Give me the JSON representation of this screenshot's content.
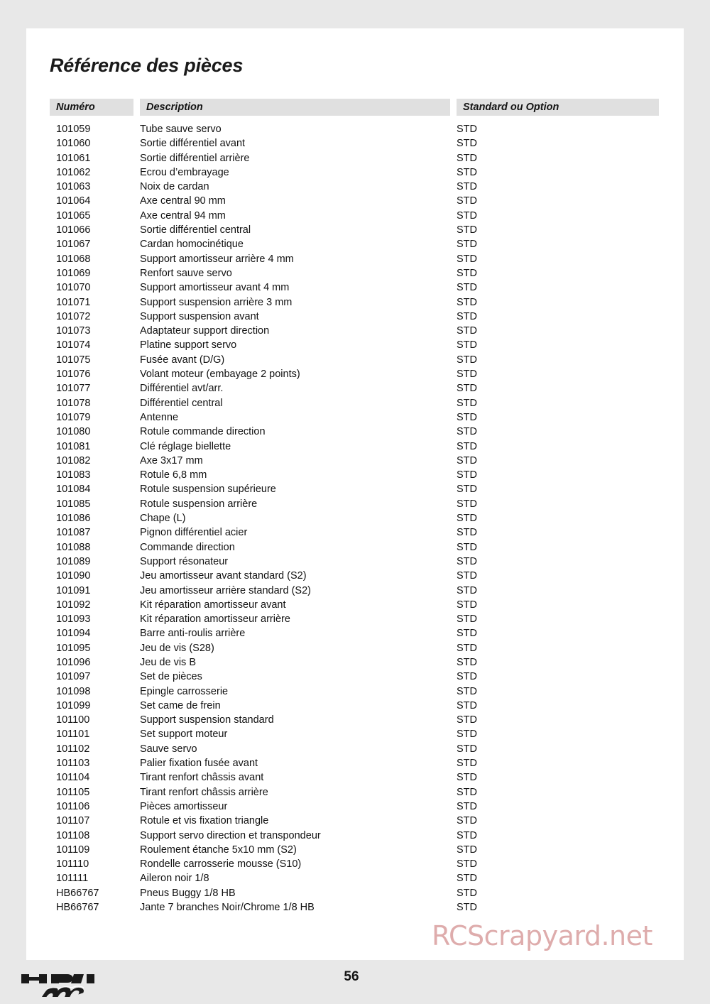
{
  "document": {
    "title": "Référence des pièces",
    "page_number": "56",
    "watermark": "RCScrapyard.net",
    "brand_logo": "hpi-racing-logo"
  },
  "table": {
    "columns": [
      {
        "key": "number",
        "label": "Numéro"
      },
      {
        "key": "description",
        "label": "Description"
      },
      {
        "key": "option",
        "label": "Standard ou Option"
      }
    ],
    "rows": [
      {
        "number": "101059",
        "description": "Tube sauve servo",
        "option": "STD"
      },
      {
        "number": "101060",
        "description": "Sortie différentiel avant",
        "option": "STD"
      },
      {
        "number": "101061",
        "description": "Sortie différentiel arrière",
        "option": "STD"
      },
      {
        "number": "101062",
        "description": "Ecrou d’embrayage",
        "option": "STD"
      },
      {
        "number": "101063",
        "description": "Noix de cardan",
        "option": "STD"
      },
      {
        "number": "101064",
        "description": "Axe central 90 mm",
        "option": "STD"
      },
      {
        "number": "101065",
        "description": "Axe central 94 mm",
        "option": "STD"
      },
      {
        "number": "101066",
        "description": "Sortie différentiel central",
        "option": "STD"
      },
      {
        "number": "101067",
        "description": "Cardan homocinétique",
        "option": "STD"
      },
      {
        "number": "101068",
        "description": "Support amortisseur arrière 4 mm",
        "option": "STD"
      },
      {
        "number": "101069",
        "description": "Renfort sauve servo",
        "option": "STD"
      },
      {
        "number": "101070",
        "description": "Support amortisseur avant 4 mm",
        "option": "STD"
      },
      {
        "number": "101071",
        "description": "Support suspension arrière 3 mm",
        "option": "STD"
      },
      {
        "number": "101072",
        "description": "Support suspension avant",
        "option": "STD"
      },
      {
        "number": "101073",
        "description": "Adaptateur support direction",
        "option": "STD"
      },
      {
        "number": "101074",
        "description": "Platine support servo",
        "option": "STD"
      },
      {
        "number": "101075",
        "description": "Fusée avant (D/G)",
        "option": "STD"
      },
      {
        "number": "101076",
        "description": "Volant moteur (embayage 2 points)",
        "option": "STD"
      },
      {
        "number": "101077",
        "description": "Différentiel avt/arr.",
        "option": "STD"
      },
      {
        "number": "101078",
        "description": "Différentiel central",
        "option": "STD"
      },
      {
        "number": "101079",
        "description": "Antenne",
        "option": "STD"
      },
      {
        "number": "101080",
        "description": "Rotule commande direction",
        "option": "STD"
      },
      {
        "number": "101081",
        "description": "Clé réglage biellette",
        "option": "STD"
      },
      {
        "number": "101082",
        "description": "Axe 3x17 mm",
        "option": "STD"
      },
      {
        "number": "101083",
        "description": "Rotule 6,8 mm",
        "option": "STD"
      },
      {
        "number": "101084",
        "description": "Rotule suspension supérieure",
        "option": "STD"
      },
      {
        "number": "101085",
        "description": "Rotule suspension arrière",
        "option": "STD"
      },
      {
        "number": "101086",
        "description": "Chape (L)",
        "option": "STD"
      },
      {
        "number": "101087",
        "description": "Pignon différentiel acier",
        "option": "STD"
      },
      {
        "number": "101088",
        "description": "Commande direction",
        "option": "STD"
      },
      {
        "number": "101089",
        "description": "Support résonateur",
        "option": "STD"
      },
      {
        "number": "101090",
        "description": "Jeu amortisseur avant standard (S2)",
        "option": "STD"
      },
      {
        "number": "101091",
        "description": "Jeu amortisseur arrière standard (S2)",
        "option": "STD"
      },
      {
        "number": "101092",
        "description": "Kit réparation amortisseur avant",
        "option": "STD"
      },
      {
        "number": "101093",
        "description": "Kit réparation amortisseur arrière",
        "option": "STD"
      },
      {
        "number": "101094",
        "description": "Barre anti-roulis arrière",
        "option": "STD"
      },
      {
        "number": "101095",
        "description": "Jeu de vis (S28)",
        "option": "STD"
      },
      {
        "number": "101096",
        "description": "Jeu de vis B",
        "option": "STD"
      },
      {
        "number": "101097",
        "description": "Set de pièces",
        "option": "STD"
      },
      {
        "number": "101098",
        "description": "Epingle carrosserie",
        "option": "STD"
      },
      {
        "number": "101099",
        "description": "Set came de frein",
        "option": "STD"
      },
      {
        "number": "101100",
        "description": "Support suspension standard",
        "option": "STD"
      },
      {
        "number": "101101",
        "description": "Set support moteur",
        "option": "STD"
      },
      {
        "number": "101102",
        "description": "Sauve servo",
        "option": "STD"
      },
      {
        "number": "101103",
        "description": "Palier fixation fusée avant",
        "option": "STD"
      },
      {
        "number": "101104",
        "description": "Tirant renfort châssis avant",
        "option": "STD"
      },
      {
        "number": "101105",
        "description": "Tirant renfort châssis arrière",
        "option": "STD"
      },
      {
        "number": "101106",
        "description": "Pièces amortisseur",
        "option": "STD"
      },
      {
        "number": "101107",
        "description": "Rotule et vis fixation triangle",
        "option": "STD"
      },
      {
        "number": "101108",
        "description": "Support servo direction et transpondeur",
        "option": "STD"
      },
      {
        "number": "101109",
        "description": "Roulement étanche 5x10 mm (S2)",
        "option": "STD"
      },
      {
        "number": "101110",
        "description": "Rondelle carrosserie mousse (S10)",
        "option": "STD"
      },
      {
        "number": "101111",
        "description": "Aileron noir 1/8",
        "option": "STD"
      },
      {
        "number": "HB66767",
        "description": "Pneus Buggy 1/8 HB",
        "option": "STD"
      },
      {
        "number": "HB66767",
        "description": "Jante 7 branches Noir/Chrome 1/8 HB",
        "option": "STD"
      }
    ]
  },
  "colors": {
    "page_background": "#e8e8e8",
    "sheet": "#ffffff",
    "table_header": "#e0e0e0",
    "text": "#111111",
    "watermark": "#dda8a8"
  }
}
